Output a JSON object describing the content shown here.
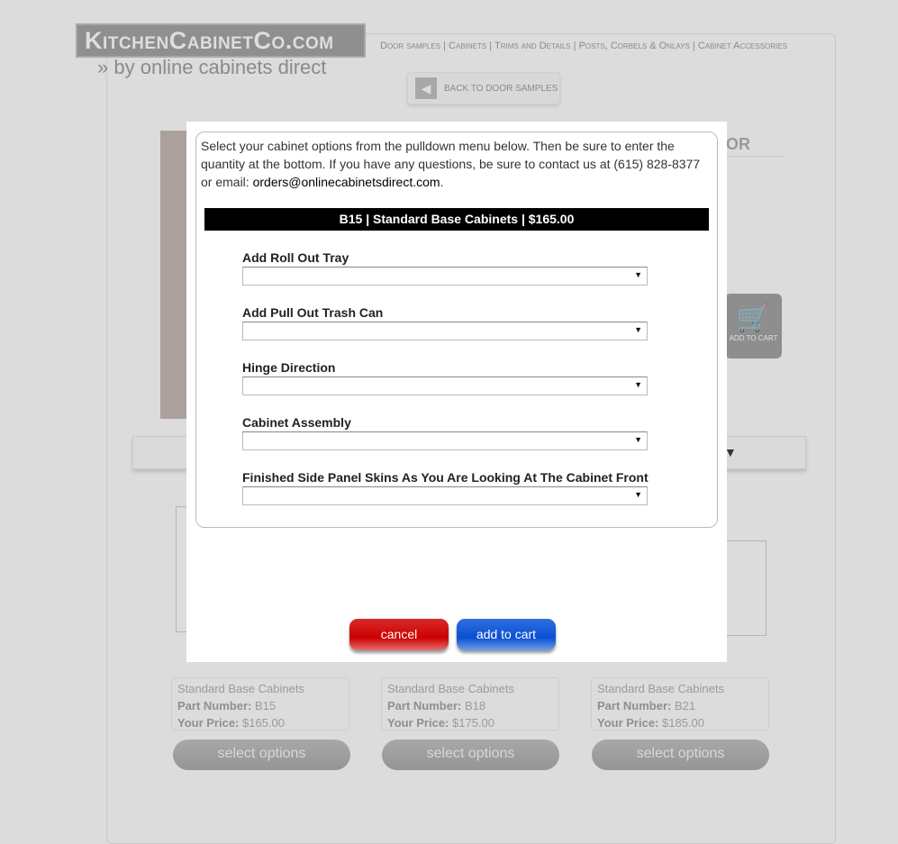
{
  "header": {
    "logo": "KitchenCabinetCo.com",
    "tagline": "by online cabinets direct",
    "nav": [
      "Door samples",
      "Cabinets",
      "Trims and Details",
      "Posts, Corbels & Onlays",
      "Cabinet Accessories"
    ],
    "back_label": "BACK TO DOOR SAMPLES"
  },
  "product": {
    "heading_fragment": "OR",
    "add_to_cart_label": "ADD TO CART"
  },
  "modal": {
    "intro": "Select your cabinet options from the pulldown menu below. Then be sure to enter the quantity at the bottom. If you have any questions, be sure to contact us at (615) 828-8377 or email: ",
    "email": "orders@onlinecabinetsdirect.com",
    "title": "B15 | Standard Base Cabinets | $165.00",
    "fields": [
      {
        "label": "Add Roll Out Tray",
        "value": ""
      },
      {
        "label": "Add Pull Out Trash Can",
        "value": ""
      },
      {
        "label": "Hinge Direction",
        "value": ""
      },
      {
        "label": "Cabinet Assembly",
        "value": ""
      },
      {
        "label": "Finished Side Panel Skins As You Are Looking At The Cabinet Front",
        "value": ""
      }
    ],
    "cancel_label": "cancel",
    "add_label": "add to cart"
  },
  "cards": [
    {
      "name": "Standard Base Cabinets",
      "part_label": "Part Number:",
      "part": "B15",
      "price_label": "Your Price:",
      "price": "$165.00",
      "button": "select options"
    },
    {
      "name": "Standard Base Cabinets",
      "part_label": "Part Number:",
      "part": "B18",
      "price_label": "Your Price:",
      "price": "$175.00",
      "button": "select options"
    },
    {
      "name": "Standard Base Cabinets",
      "part_label": "Part Number:",
      "part": "B21",
      "price_label": "Your Price:",
      "price": "$185.00",
      "button": "select options"
    }
  ]
}
